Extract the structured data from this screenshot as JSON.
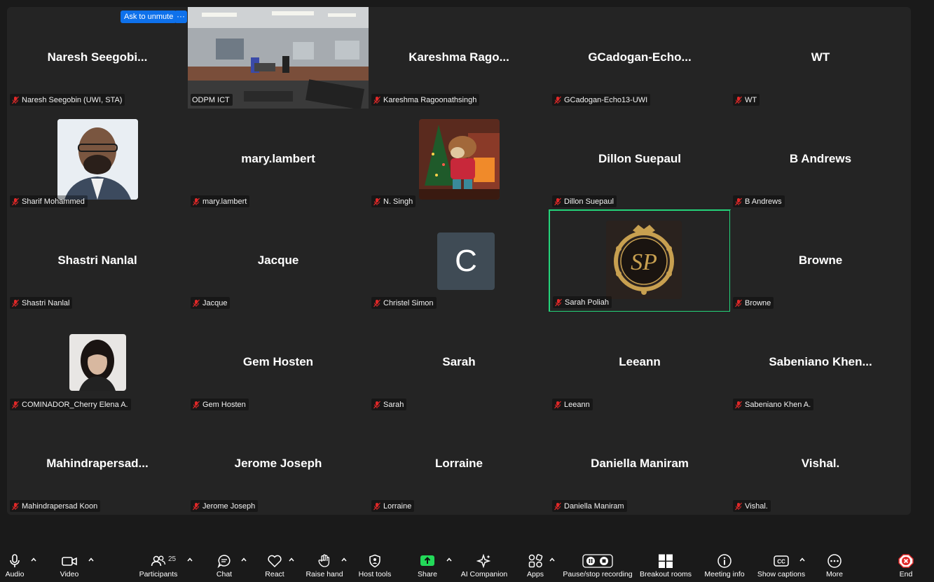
{
  "controls": {
    "ask_to_unmute": "Ask to unmute",
    "more_dots": "···"
  },
  "tiles": [
    {
      "big": "Naresh  Seegobi...",
      "label": "Naresh Seegobin (UWI, STA)"
    },
    {
      "big": "",
      "label": "ODPM ICT"
    },
    {
      "big": "Kareshma  Rago...",
      "label": "Kareshma Ragoonathsingh"
    },
    {
      "big": "GCadogan-Echo...",
      "label": "GCadogan-Echo13-UWI"
    },
    {
      "big": "WT",
      "label": "WT"
    },
    {
      "big": "",
      "label": "Sharif Mohammed"
    },
    {
      "big": "mary.lambert",
      "label": "mary.lambert"
    },
    {
      "big": "",
      "label": "N. Singh"
    },
    {
      "big": "Dillon Suepaul",
      "label": "Dillon Suepaul"
    },
    {
      "big": "B Andrews",
      "label": "B Andrews"
    },
    {
      "big": "Shastri Nanlal",
      "label": "Shastri Nanlal"
    },
    {
      "big": "Jacque",
      "label": "Jacque"
    },
    {
      "big": "",
      "label": "Christel Simon",
      "initial": "C"
    },
    {
      "big": "",
      "label": "Sarah Poliah"
    },
    {
      "big": "Browne",
      "label": "Browne"
    },
    {
      "big": "",
      "label": "COMINADOR_Cherry Elena A."
    },
    {
      "big": "Gem Hosten",
      "label": "Gem Hosten"
    },
    {
      "big": "Sarah",
      "label": "Sarah"
    },
    {
      "big": "Leeann",
      "label": "Leeann"
    },
    {
      "big": "Sabeniano  Khen...",
      "label": "Sabeniano Khen A."
    },
    {
      "big": "Mahindrapersad...",
      "label": "Mahindrapersad Koon"
    },
    {
      "big": "Jerome Joseph",
      "label": "Jerome Joseph"
    },
    {
      "big": "Lorraine",
      "label": "Lorraine"
    },
    {
      "big": "Daniella Maniram",
      "label": "Daniella Maniram"
    },
    {
      "big": "Vishal.",
      "label": "Vishal."
    }
  ],
  "toolbar": {
    "audio": "Audio",
    "video": "Video",
    "participants": "Participants",
    "participants_count": "25",
    "chat": "Chat",
    "react": "React",
    "raise_hand": "Raise hand",
    "host_tools": "Host tools",
    "share": "Share",
    "ai_companion": "AI Companion",
    "apps": "Apps",
    "pause_stop_recording": "Pause/stop recording",
    "breakout_rooms": "Breakout rooms",
    "meeting_info": "Meeting info",
    "show_captions": "Show captions",
    "more": "More",
    "end": "End"
  },
  "colors": {
    "active_speaker_border": "#24d37a",
    "accent_blue": "#0e71eb",
    "share_green": "#23d959",
    "end_red": "#e02828",
    "mic_muted_red": "#e02828"
  }
}
